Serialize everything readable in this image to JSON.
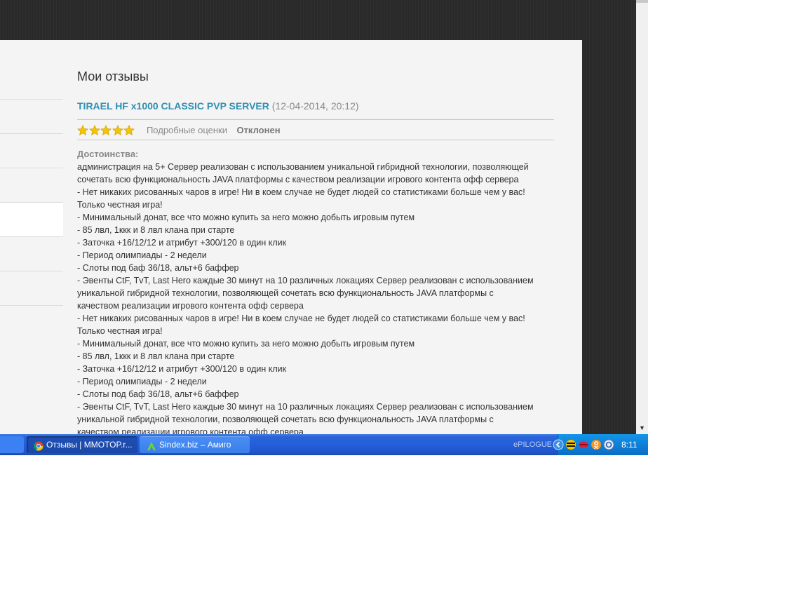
{
  "page": {
    "title": "Мои отзывы",
    "review": {
      "server_name": "TIRAEL HF x1000 CLASSIC PVP SERVER",
      "date": "(12-04-2014, 20:12)",
      "stars": 5,
      "detailed_ratings_label": "Подробные оценки",
      "status": "Отклонен",
      "advantages_label": "Достоинства:",
      "body_lines": [
        "администрация на 5+ Сервер реализован с использованием уникальной гибридной технологии, позволяющей",
        "сочетать всю функциональность JAVA платформы с качеством реализации игрового контента офф сервера",
        "- Нет никаких рисованных чаров в игре! Ни в коем случае не будет людей со статистиками больше чем у вас!",
        "Только честная игра!",
        "- Минимальный донат, все что можно купить за него можно добыть игровым путем",
        "- 85 лвл, 1ккк и 8 лвл клана при старте",
        "- Заточка +16/12/12 и атрибут +300/120 в один клик",
        "- Период олимпиады - 2 недели",
        "- Слоты под баф 36/18, альт+6 баффер",
        "- Эвенты CtF, TvT, Last Hero каждые 30 минут на 10 различных локациях Сервер реализован с использованием",
        "уникальной гибридной технологии, позволяющей сочетать всю функциональность JAVA платформы с",
        "качеством реализации игрового контента офф сервера",
        "- Нет никаких рисованных чаров в игре! Ни в коем случае не будет людей со статистиками больше чем у вас!",
        "Только честная игра!",
        "- Минимальный донат, все что можно купить за него можно добыть игровым путем",
        "- 85 лвл, 1ккк и 8 лвл клана при старте",
        "- Заточка +16/12/12 и атрибут +300/120 в один клик",
        "- Период олимпиады - 2 недели",
        "- Слоты под баф 36/18, альт+6 баффер",
        "- Эвенты CtF, TvT, Last Hero каждые 30 минут на 10 различных локациях Сервер реализован с использованием",
        "уникальной гибридной технологии, позволяющей сочетать всю функциональность JAVA платформы с",
        "качеством реализации игрового контента офф сервера"
      ]
    }
  },
  "taskbar": {
    "tasks": [
      {
        "label": "Отзывы | MMOTOP.r...",
        "icon": "chrome-icon",
        "active": true
      },
      {
        "label": "Sindex.biz – Амиго",
        "icon": "amigo-icon",
        "active": false
      }
    ],
    "tray_label": "ePILOGUE",
    "clock": "8:11",
    "tray_icons": [
      "back-arrow-icon",
      "beeline-icon",
      "lips-icon",
      "odnoklassniki-icon",
      "messenger-icon"
    ]
  },
  "colors": {
    "link": "#2f8fb4",
    "star": "#f5c400",
    "taskbar": "#245edb",
    "tray": "#0f80d8"
  }
}
